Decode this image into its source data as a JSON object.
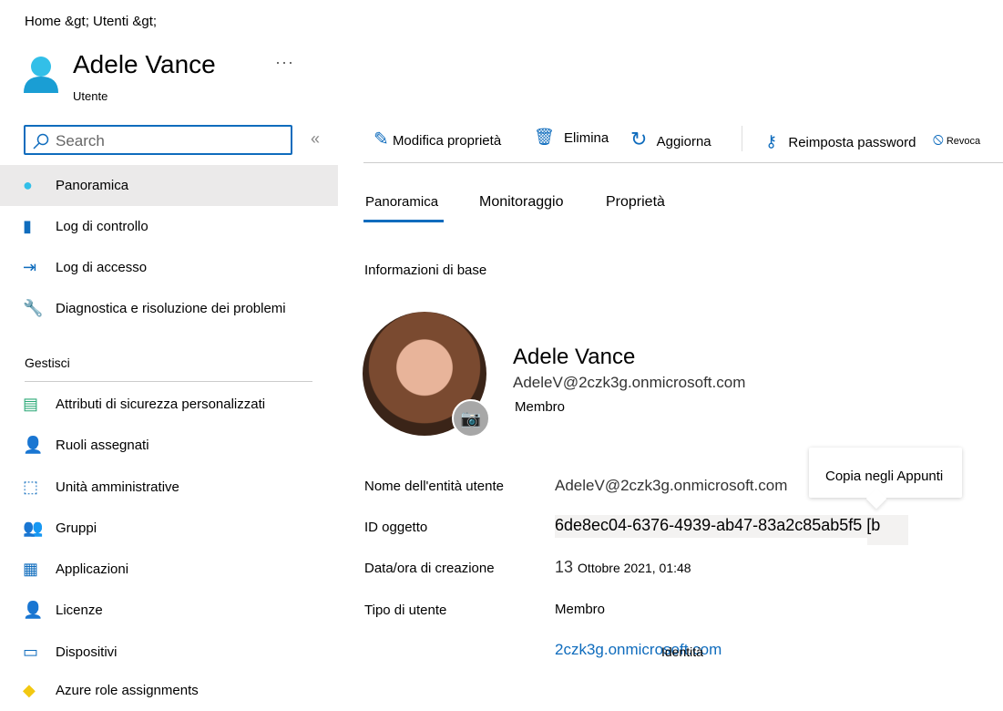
{
  "breadcrumb": "Home &gt;  Utenti &gt;",
  "header": {
    "title": "Adele Vance",
    "subtitle": "Utente",
    "more": "···"
  },
  "search": {
    "placeholder": "Search"
  },
  "sidebar": {
    "items": [
      {
        "label": "Panoramica",
        "icon": "user-icon",
        "selected": true
      },
      {
        "label": "Log di controllo",
        "icon": "log-icon"
      },
      {
        "label": "Log di accesso",
        "icon": "sign-in-icon"
      },
      {
        "label": "Diagnostica e risoluzione dei problemi",
        "icon": "wrench-icon"
      }
    ],
    "section": "Gestisci",
    "manage": [
      {
        "label": "Attributi di sicurezza personalizzati",
        "icon": "attributes-icon"
      },
      {
        "label": "Ruoli assegnati",
        "icon": "roles-icon"
      },
      {
        "label": "Unità amministrative",
        "icon": "admin-units-icon"
      },
      {
        "label": "Gruppi",
        "icon": "groups-icon"
      },
      {
        "label": "Applicazioni",
        "icon": "apps-icon"
      },
      {
        "label": "Licenze",
        "icon": "license-icon"
      },
      {
        "label": "Dispositivi",
        "icon": "devices-icon"
      },
      {
        "label": "Azure role assignments",
        "icon": "azure-role-icon"
      }
    ]
  },
  "toolbar": {
    "edit": "Modifica proprietà",
    "delete": "Elimina",
    "refresh": "Aggiorna",
    "reset": "Reimposta password",
    "revoke": "Revoca"
  },
  "tabs": [
    "Panoramica",
    "Monitoraggio",
    "Proprietà"
  ],
  "basic": {
    "heading": "Informazioni di base",
    "name": "Adele Vance",
    "email": "AdeleV@2czk3g.onmicrosoft.com",
    "type": "Membro"
  },
  "props": {
    "upn_label": "Nome dell'entità utente",
    "upn": "AdeleV@2czk3g.onmicrosoft.com",
    "id_label": "ID oggetto",
    "id": "6de8ec04-6376-4939-ab47-83a2c85ab5f5 [b",
    "created_label": "Data/ora di creazione",
    "created_day": "13",
    "created_rest": "Ottobre 2021, 01:48",
    "type_label": "Tipo di utente",
    "type": "Membro",
    "domain": "2czk3g.onmicrosoft.com",
    "identity": "Identità"
  },
  "tooltip": "Copia negli Appunti",
  "colors": {
    "accent": "#0f6cbd",
    "selected": "#ebeaea"
  }
}
